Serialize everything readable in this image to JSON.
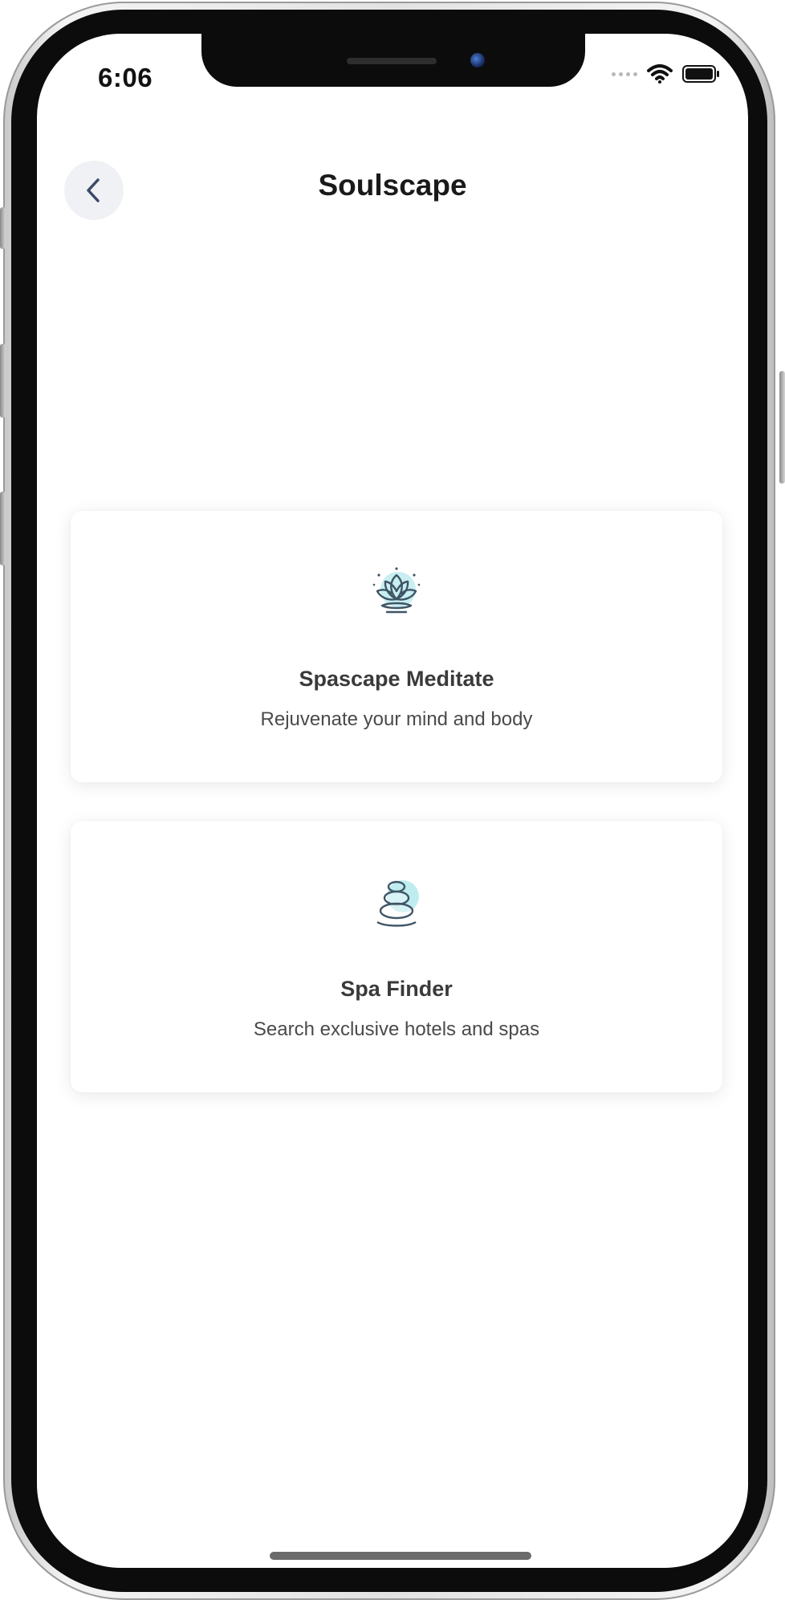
{
  "status_bar": {
    "time": "6:06",
    "icons": [
      "signal-dots-icon",
      "wifi-icon",
      "battery-icon"
    ]
  },
  "header": {
    "title": "Soulscape",
    "back_icon": "chevron-left-icon"
  },
  "cards": [
    {
      "icon": "lotus-icon",
      "title": "Spascape Meditate",
      "subtitle": "Rejuvenate your mind and body"
    },
    {
      "icon": "stacked-stones-icon",
      "title": "Spa Finder",
      "subtitle": "Search exclusive hotels and spas"
    }
  ],
  "colors": {
    "accent_teal": "#5ecfd6",
    "icon_stroke": "#3f5566",
    "back_button_bg": "#f0f1f4",
    "title_text": "#1a1a1a"
  }
}
